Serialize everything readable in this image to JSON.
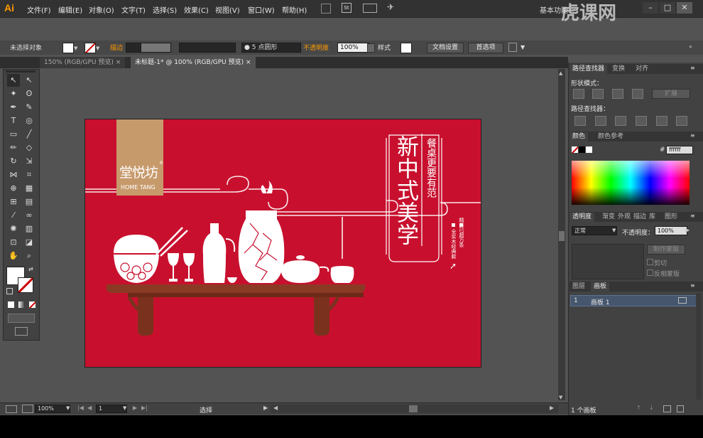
{
  "app": {
    "logo": "Ai",
    "workspace": "基本功能",
    "watermark": "虎课网"
  },
  "menu": [
    "文件(F)",
    "编辑(E)",
    "对象(O)",
    "文字(T)",
    "选择(S)",
    "效果(C)",
    "视图(V)",
    "窗口(W)",
    "帮助(H)"
  ],
  "menu_icons": {
    "bridge": "Br",
    "stock": "St"
  },
  "control": {
    "selection": "未选择对象",
    "stroke_label": "描边",
    "brush_dot": "●",
    "brush_size": "5",
    "brush_shape": "点圆形",
    "opacity_label": "不透明度",
    "opacity_value": "100%",
    "style_label": "样式",
    "doc_setup": "文档设置",
    "preferences": "首选项"
  },
  "tabs": [
    {
      "label": "150% (RGB/GPU 预览)",
      "active": false
    },
    {
      "label": "未标题-1* @ 100% (RGB/GPU 预览)",
      "active": true
    }
  ],
  "tab_close": "×",
  "artwork": {
    "logo_cn": "堂悦坊",
    "logo_en": "HOME TANG",
    "reg": "®",
    "title": "新中式美学",
    "subtitle": "餐桌更要有范",
    "tagline1": "全实木经典款",
    "tagline2": "精美已超万条"
  },
  "status": {
    "zoom": "100%",
    "page": "1",
    "mode": "选择"
  },
  "panels": {
    "pathfinder": {
      "tabs": [
        "路径查找器",
        "变换",
        "对齐"
      ],
      "shape_modes": "形状模式：",
      "expand": "扩展",
      "pathfinders": "路径查找器："
    },
    "color": {
      "tabs": [
        "颜色",
        "颜色参考"
      ],
      "hex_prefix": "#",
      "hex": "ffffff"
    },
    "transparency": {
      "tabs": [
        "透明度",
        "渐变",
        "外观",
        "描边",
        "库",
        "图形"
      ],
      "blend": "正常",
      "opacity_label": "不透明度：",
      "opacity": "100%",
      "make_mask": "制作蒙版",
      "clip": "剪切",
      "invert": "反相蒙版"
    },
    "layers": {
      "tabs": [
        "图层",
        "画板"
      ],
      "row_num": "1",
      "row_label": "画板 1",
      "footer": "1 个画板"
    }
  },
  "colors": {
    "artboard": "#c8102e",
    "logo_box": "#c79a6c",
    "table": "#8a3a24",
    "accent": "#ff9a00"
  }
}
